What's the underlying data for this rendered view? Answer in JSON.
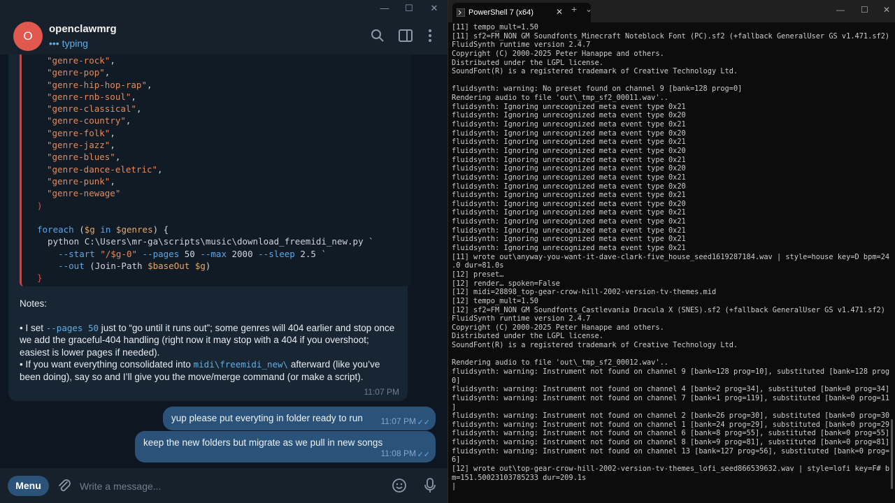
{
  "telegram": {
    "chat_name": "openclawmrg",
    "avatar_letter": "O",
    "status_dots": "•••",
    "status": "typing",
    "code_lines": [
      [
        {
          "t": "\"genre-rock\"",
          "c": "str"
        },
        {
          "t": ",",
          "c": "op"
        }
      ],
      [
        {
          "t": "\"genre-pop\"",
          "c": "str"
        },
        {
          "t": ",",
          "c": "op"
        }
      ],
      [
        {
          "t": "\"genre-hip-hop-rap\"",
          "c": "str"
        },
        {
          "t": ",",
          "c": "op"
        }
      ],
      [
        {
          "t": "\"genre-rnb-soul\"",
          "c": "str"
        },
        {
          "t": ",",
          "c": "op"
        }
      ],
      [
        {
          "t": "\"genre-classical\"",
          "c": "str"
        },
        {
          "t": ",",
          "c": "op"
        }
      ],
      [
        {
          "t": "\"genre-country\"",
          "c": "str"
        },
        {
          "t": ",",
          "c": "op"
        }
      ],
      [
        {
          "t": "\"genre-folk\"",
          "c": "str"
        },
        {
          "t": ",",
          "c": "op"
        }
      ],
      [
        {
          "t": "\"genre-jazz\"",
          "c": "str"
        },
        {
          "t": ",",
          "c": "op"
        }
      ],
      [
        {
          "t": "\"genre-blues\"",
          "c": "str"
        },
        {
          "t": ",",
          "c": "op"
        }
      ],
      [
        {
          "t": "\"genre-dance-eletric\"",
          "c": "str"
        },
        {
          "t": ",",
          "c": "op"
        }
      ],
      [
        {
          "t": "\"genre-punk\"",
          "c": "str"
        },
        {
          "t": ",",
          "c": "op"
        }
      ],
      [
        {
          "t": "\"genre-newage\"",
          "c": "str"
        }
      ],
      [
        {
          "t": ")",
          "c": "brace"
        }
      ],
      [],
      [
        {
          "t": "foreach",
          "c": "kw"
        },
        {
          "t": " (",
          "c": "op"
        },
        {
          "t": "$g",
          "c": "var"
        },
        {
          "t": " in ",
          "c": "kw"
        },
        {
          "t": "$genres",
          "c": "var"
        },
        {
          "t": ") {",
          "c": "op"
        }
      ],
      [
        {
          "t": "  python C:\\Users\\mr-ga\\scripts\\music\\download_freemidi_new.py `",
          "c": "op"
        }
      ],
      [
        {
          "t": "    ",
          "c": "op"
        },
        {
          "t": "--start",
          "c": "flag"
        },
        {
          "t": " ",
          "c": "op"
        },
        {
          "t": "\"/$g-0\"",
          "c": "str"
        },
        {
          "t": " ",
          "c": "op"
        },
        {
          "t": "--pages",
          "c": "flag"
        },
        {
          "t": " 50 ",
          "c": "op"
        },
        {
          "t": "--max",
          "c": "flag"
        },
        {
          "t": " 2000 ",
          "c": "op"
        },
        {
          "t": "--sleep",
          "c": "flag"
        },
        {
          "t": " 2.5 `",
          "c": "op"
        }
      ],
      [
        {
          "t": "    ",
          "c": "op"
        },
        {
          "t": "--out",
          "c": "flag"
        },
        {
          "t": " (Join-Path ",
          "c": "op"
        },
        {
          "t": "$baseOut",
          "c": "var"
        },
        {
          "t": " ",
          "c": "op"
        },
        {
          "t": "$g",
          "c": "var"
        },
        {
          "t": ")",
          "c": "op"
        }
      ],
      [
        {
          "t": "}",
          "c": "brace"
        }
      ]
    ],
    "notes_title": "Notes:",
    "note1_a": "• I set ",
    "note1_code": "--pages 50",
    "note1_b": " just to “go until it runs out”; some genres will 404 earlier and stop once we add the graceful-404 handling (right now it may stop with a 404 if you overshoot; easiest is lower pages if needed).",
    "note2_a": "• If you want everything consolidated into ",
    "note2_code": "midi\\freemidi_new\\",
    "note2_b": " afterward (like you’ve been doing), say so and I’ll give you the move/merge command (or make a script).",
    "incoming_time": "11:07 PM",
    "outgoing": [
      {
        "text": "yup please put everyting in folder ready to run",
        "time": "11:07 PM"
      },
      {
        "text": "keep the new folders but migrate as we pull  in new songs",
        "time": "11:08 PM"
      }
    ],
    "menu_label": "Menu",
    "input_placeholder": "Write a message..."
  },
  "terminal": {
    "tab_title": "PowerShell 7 (x64)",
    "lines": [
      "[11] tempo_mult=1.50",
      "[11] sf2=FM_NON GM Soundfonts_Minecraft Noteblock Font (PC).sf2 (+fallback GeneralUser GS v1.471.sf2)",
      "FluidSynth runtime version 2.4.7",
      "Copyright (C) 2000-2025 Peter Hanappe and others.",
      "Distributed under the LGPL license.",
      "SoundFont(R) is a registered trademark of Creative Technology Ltd.",
      "",
      "fluidsynth: warning: No preset found on channel 9 [bank=128 prog=0]",
      "Rendering audio to file 'out\\_tmp_sf2_00011.wav'..",
      "fluidsynth: Ignoring unrecognized meta event type 0x21",
      "fluidsynth: Ignoring unrecognized meta event type 0x20",
      "fluidsynth: Ignoring unrecognized meta event type 0x21",
      "fluidsynth: Ignoring unrecognized meta event type 0x20",
      "fluidsynth: Ignoring unrecognized meta event type 0x21",
      "fluidsynth: Ignoring unrecognized meta event type 0x20",
      "fluidsynth: Ignoring unrecognized meta event type 0x21",
      "fluidsynth: Ignoring unrecognized meta event type 0x20",
      "fluidsynth: Ignoring unrecognized meta event type 0x21",
      "fluidsynth: Ignoring unrecognized meta event type 0x20",
      "fluidsynth: Ignoring unrecognized meta event type 0x21",
      "fluidsynth: Ignoring unrecognized meta event type 0x20",
      "fluidsynth: Ignoring unrecognized meta event type 0x21",
      "fluidsynth: Ignoring unrecognized meta event type 0x21",
      "fluidsynth: Ignoring unrecognized meta event type 0x21",
      "fluidsynth: Ignoring unrecognized meta event type 0x21",
      "fluidsynth: Ignoring unrecognized meta event type 0x21",
      "[11] wrote out\\anyway-you-want-it-dave-clark-five_house_seed1619287184.wav | style=house key=D bpm=240",
      ".0 dur=81.0s",
      "[12] preset…",
      "[12] render… spoken=False",
      "[12] midi=28898_top-gear-crow-hill-2002-version-tv-themes.mid",
      "[12] tempo_mult=1.50",
      "[12] sf2=FM_NON GM Soundfonts_Castlevania Dracula X (SNES).sf2 (+fallback GeneralUser GS v1.471.sf2)",
      "FluidSynth runtime version 2.4.7",
      "Copyright (C) 2000-2025 Peter Hanappe and others.",
      "Distributed under the LGPL license.",
      "SoundFont(R) is a registered trademark of Creative Technology Ltd.",
      "",
      "Rendering audio to file 'out\\_tmp_sf2_00012.wav'..",
      "fluidsynth: warning: Instrument not found on channel 9 [bank=128 prog=10], substituted [bank=128 prog=",
      "0]",
      "fluidsynth: warning: Instrument not found on channel 4 [bank=2 prog=34], substituted [bank=0 prog=34]",
      "fluidsynth: warning: Instrument not found on channel 7 [bank=1 prog=119], substituted [bank=0 prog=119",
      "]",
      "fluidsynth: warning: Instrument not found on channel 2 [bank=26 prog=30], substituted [bank=0 prog=30]",
      "fluidsynth: warning: Instrument not found on channel 1 [bank=24 prog=29], substituted [bank=0 prog=29]",
      "fluidsynth: warning: Instrument not found on channel 6 [bank=8 prog=55], substituted [bank=0 prog=55]",
      "fluidsynth: warning: Instrument not found on channel 8 [bank=9 prog=81], substituted [bank=0 prog=81]",
      "fluidsynth: warning: Instrument not found on channel 13 [bank=127 prog=56], substituted [bank=0 prog=5",
      "6]",
      "[12] wrote out\\top-gear-crow-hill-2002-version-tv-themes_lofi_seed866539632.wav | style=lofi key=F# bp",
      "m=151.50023103785233 dur=209.1s",
      "|"
    ]
  }
}
